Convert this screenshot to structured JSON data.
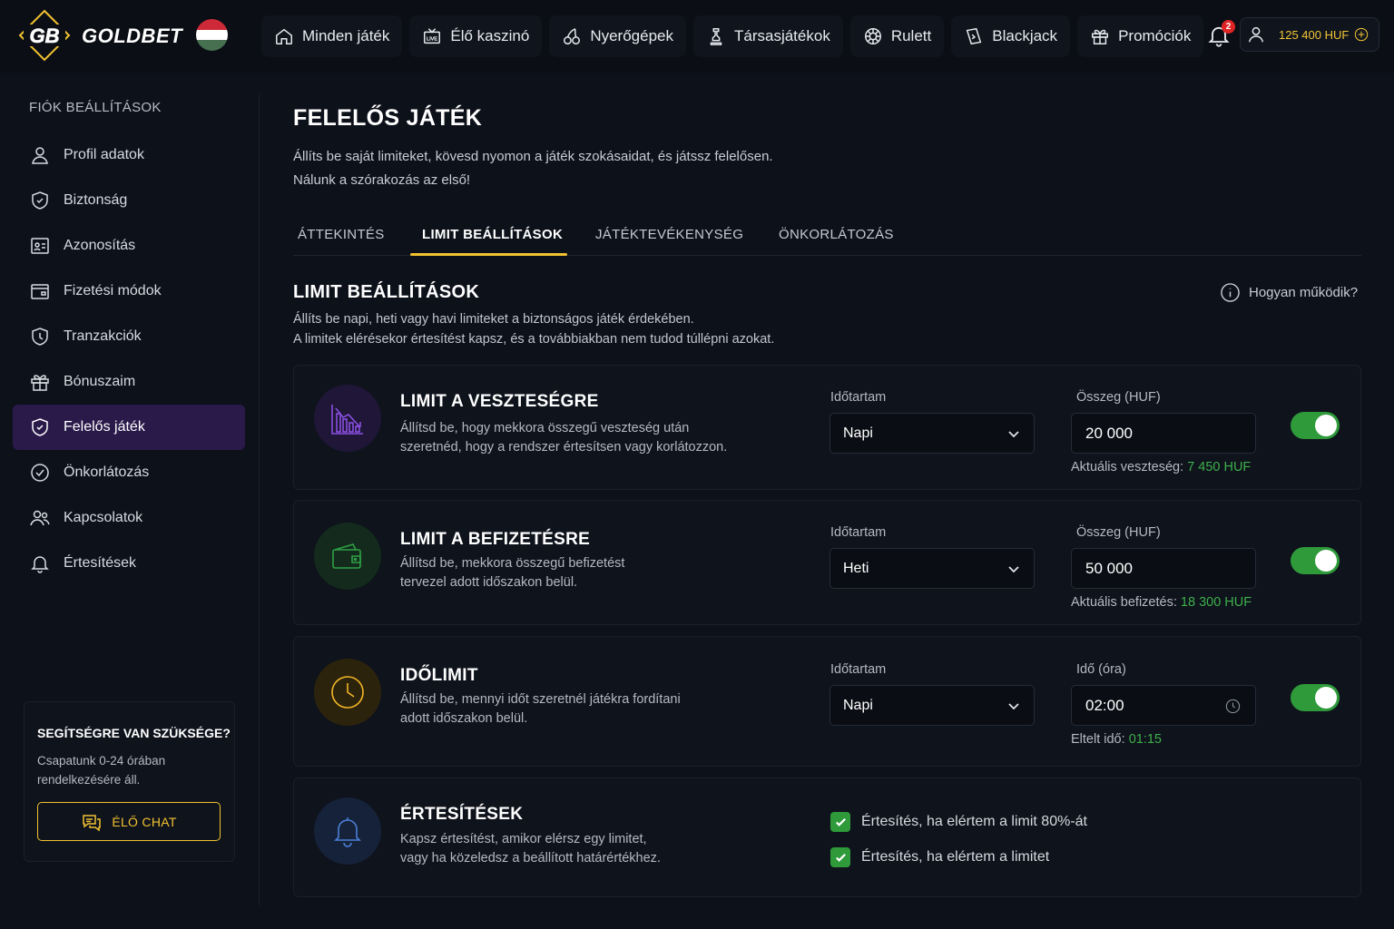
{
  "brand": {
    "name": "GOLDBET",
    "logo_mark": "GB"
  },
  "nav": [
    {
      "label": "Minden játék",
      "icon": "home-icon"
    },
    {
      "label": "Élő kaszinó",
      "icon": "tv-icon"
    },
    {
      "label": "Nyerőgépek",
      "icon": "cherries-icon"
    },
    {
      "label": "Társasjátékok",
      "icon": "chess-icon"
    },
    {
      "label": "Rulett",
      "icon": "roulette-icon"
    },
    {
      "label": "Blackjack",
      "icon": "card-icon"
    },
    {
      "label": "Promóciók",
      "icon": "gift-icon"
    }
  ],
  "header": {
    "notification_count": "2",
    "balance": "125 400 HUF"
  },
  "sidebar": {
    "title": "FIÓK BEÁLLÍTÁSOK",
    "items": [
      {
        "label": "Profil adatok",
        "icon": "user-icon"
      },
      {
        "label": "Biztonság",
        "icon": "shield-icon"
      },
      {
        "label": "Azonosítás",
        "icon": "id-card-icon"
      },
      {
        "label": "Fizetési módok",
        "icon": "wallet-icon"
      },
      {
        "label": "Tranzakciók",
        "icon": "clock-shield-icon"
      },
      {
        "label": "Bónuszaim",
        "icon": "gift-icon"
      },
      {
        "label": "Felelős játék",
        "icon": "shield-check-icon",
        "active": true
      },
      {
        "label": "Önkorlátozás",
        "icon": "check-circle-icon"
      },
      {
        "label": "Kapcsolatok",
        "icon": "users-icon"
      },
      {
        "label": "Értesítések",
        "icon": "bell-icon"
      }
    ],
    "help": {
      "title": "SEGÍTSÉGRE VAN SZÜKSÉGE?",
      "text": "Csapatunk 0-24 órában rendelkezésére áll.",
      "button": "ÉLŐ CHAT"
    }
  },
  "page": {
    "title": "FELELŐS JÁTÉK",
    "subtitle_line1": "Állíts be saját limiteket, kövesd nyomon a játék szokásaidat, és játssz felelősen.",
    "subtitle_line2": "Nálunk a szórakozás az első!",
    "tabs": [
      "ÁTTEKINTÉS",
      "LIMIT BEÁLLÍTÁSOK",
      "JÁTÉKTEVÉKENYSÉG",
      "ÖNKORLÁTOZÁS"
    ],
    "active_tab": "LIMIT BEÁLLÍTÁSOK"
  },
  "limits": {
    "title": "LIMIT BEÁLLÍTÁSOK",
    "desc_line1": "Állíts be napi, heti vagy havi limiteket a biztonságos játék érdekében.",
    "desc_line2": "A limitek elérésekor értesítést kapsz, és a továbbiakban nem tudod túllépni azokat.",
    "how_link": "Hogyan működik?",
    "loss": {
      "title": "LIMIT A VESZTESÉGRE",
      "desc_line1": "Állítsd be, hogy mekkora összegű veszteség után",
      "desc_line2": "szeretnéd, hogy a rendszer értesítsen vagy korlátozzon.",
      "period_label": "Időtartam",
      "period": "Napi",
      "amount_label": "Összeg (HUF)",
      "amount": "20 000",
      "meta_label": "Aktuális veszteség:",
      "meta_value": "7 450 HUF",
      "enabled": true
    },
    "deposit": {
      "title": "LIMIT A BEFIZETÉSRE",
      "desc_line1": "Állítsd be, mekkora összegű befizetést",
      "desc_line2": "tervezel adott időszakon belül.",
      "period_label": "Időtartam",
      "period": "Heti",
      "amount_label": "Összeg (HUF)",
      "amount": "50 000",
      "meta_label": "Aktuális befizetés:",
      "meta_value": "18 300 HUF",
      "enabled": true
    },
    "time": {
      "title": "IDŐLIMIT",
      "desc_line1": "Állítsd be, mennyi időt szeretnél játékra fordítani",
      "desc_line2": "adott időszakon belül.",
      "period_label": "Időtartam",
      "period": "Napi",
      "amount_label": "Idő (óra)",
      "amount": "02:00",
      "meta_label": "Eltelt idő:",
      "meta_value": "01:15",
      "enabled": true
    },
    "notifications": {
      "title": "ÉRTESÍTÉSEK",
      "desc_line1": "Kapsz értesítést, amikor elérsz egy limitet,",
      "desc_line2": "vagy ha közeledsz a beállított határértékhez.",
      "option1": "Értesítés, ha elértem a limit 80%-át",
      "option2": "Értesítés, ha elértem a limitet",
      "option1_checked": true,
      "option2_checked": true
    }
  },
  "colors": {
    "accent_gold": "#f2c231",
    "success_green": "#2e9a3a",
    "active_purple": "#2a1a4a",
    "background": "#0d111a"
  }
}
